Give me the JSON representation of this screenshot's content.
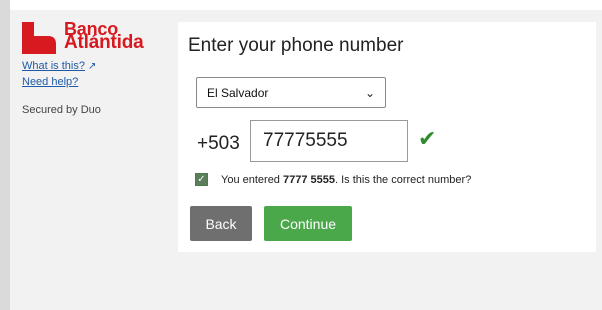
{
  "brand": {
    "line1": "Banco",
    "line2": "Atlántida",
    "color": "#d71920"
  },
  "sidebar": {
    "what_is_this": "What is this?",
    "what_is_this_icon": "external-link-icon",
    "need_help": "Need help?",
    "secured_by": "Secured by Duo"
  },
  "form": {
    "title": "Enter your phone number",
    "country": "El Salvador",
    "dial_prefix": "+503",
    "phone_value": "77775555",
    "valid_icon": "checkmark-icon",
    "confirm_prefix": "You entered ",
    "confirm_number": "7777 5555",
    "confirm_suffix": ". Is this the correct number?",
    "confirm_checked": true,
    "back_label": "Back",
    "continue_label": "Continue"
  },
  "colors": {
    "back_button": "#6f6f6f",
    "continue_button": "#4aa84a",
    "valid_check": "#2e8b2e",
    "link": "#1f5aa6"
  }
}
